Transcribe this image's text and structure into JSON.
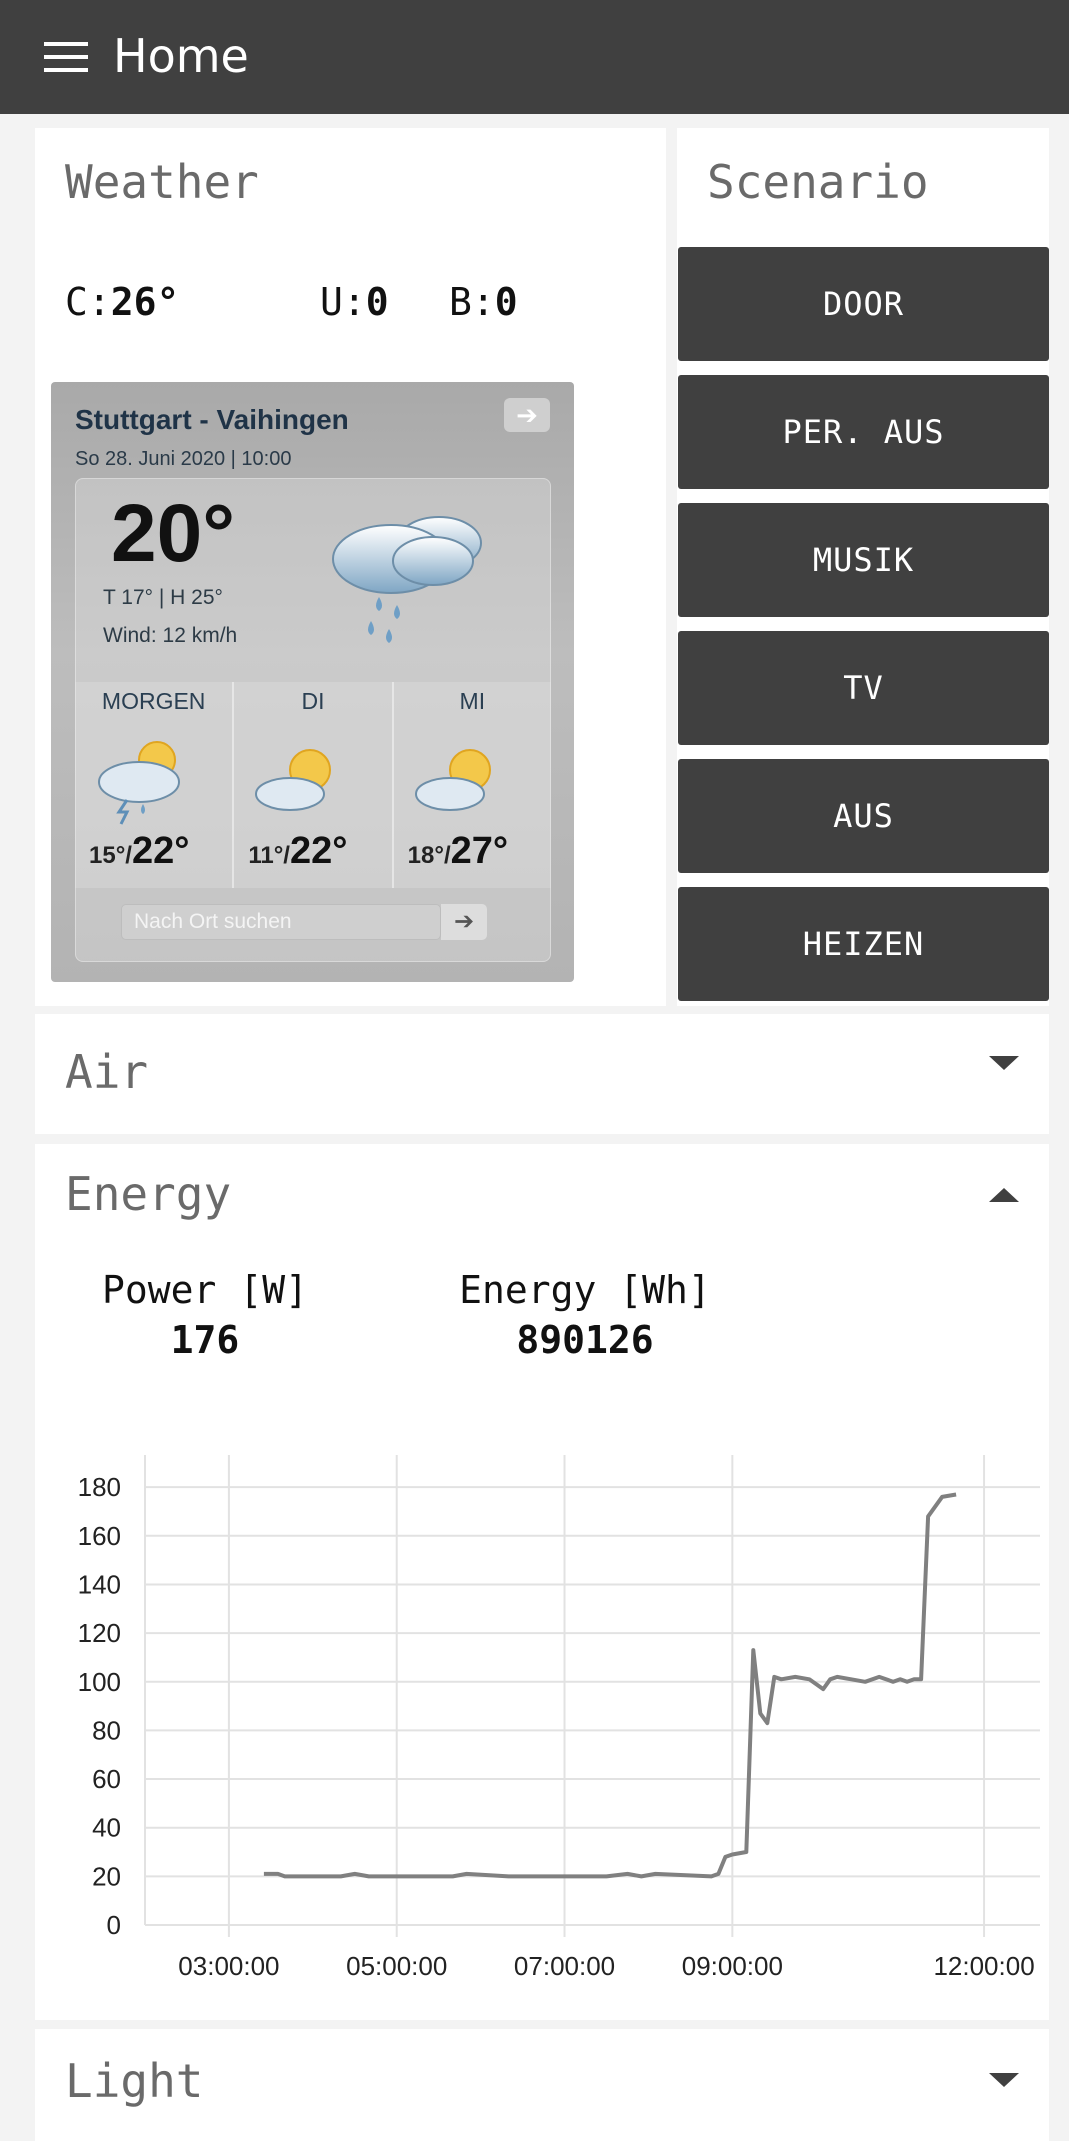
{
  "app": {
    "title": "Home",
    "menu_icon": "hamburger-menu-icon"
  },
  "weather": {
    "title": "Weather",
    "metrics": [
      {
        "key": "C:",
        "value": "26°"
      },
      {
        "key": "U:",
        "value": "0"
      },
      {
        "key": "B:",
        "value": "0"
      }
    ],
    "widget": {
      "city": "Stuttgart - Vaihingen",
      "date": "So 28. Juni 2020 | 10:00",
      "temp": "20°",
      "details": "T 17° | H 25°",
      "wind": "Wind: 12 km/h",
      "current_icon": "rain-cloud-icon",
      "days": [
        {
          "name": "MORGEN",
          "low": "15°/",
          "high": "22°",
          "icon": "thunder-sun-cloud-icon"
        },
        {
          "name": "DI",
          "low": "11°/",
          "high": "22°",
          "icon": "sun-cloud-icon"
        },
        {
          "name": "MI",
          "low": "18°/",
          "high": "27°",
          "icon": "sun-cloud-icon"
        }
      ],
      "search_placeholder": "Nach Ort suchen",
      "arrow_glyph": "➔"
    }
  },
  "scenario": {
    "title": "Scenario",
    "buttons": [
      "DOOR",
      "PER. AUS",
      "MUSIK",
      "TV",
      "AUS",
      "HEIZEN"
    ]
  },
  "sections": {
    "air": "Air",
    "energy": "Energy",
    "light": "Light"
  },
  "energy": {
    "power_label": "Power [W]",
    "power_value": "176",
    "energy_label": "Energy [Wh]",
    "energy_value": "890126"
  },
  "chart_data": {
    "type": "line",
    "title": "",
    "xlabel": "",
    "ylabel": "",
    "x_ticks": [
      "03:00:00",
      "05:00:00",
      "07:00:00",
      "09:00:00",
      "12:00:00"
    ],
    "y_ticks": [
      0,
      20,
      40,
      60,
      80,
      100,
      120,
      140,
      160,
      180
    ],
    "ylim": [
      0,
      185
    ],
    "xlim": [
      "02:00:00",
      "12:40:00"
    ],
    "grid": true,
    "color": "#808080",
    "series": [
      {
        "x": [
          "03:25",
          "03:35",
          "03:40",
          "04:00",
          "04:20",
          "04:30",
          "04:40",
          "05:00",
          "05:40",
          "05:50",
          "06:20",
          "07:30",
          "07:45",
          "07:55",
          "08:05",
          "08:45",
          "08:50",
          "08:55",
          "09:00",
          "09:10",
          "09:15",
          "09:20",
          "09:25",
          "09:30",
          "09:35",
          "09:45",
          "09:55",
          "10:05",
          "10:10",
          "10:15",
          "10:25",
          "10:35",
          "10:45",
          "10:55",
          "11:00",
          "11:05",
          "11:10",
          "11:15",
          "11:20",
          "11:30",
          "11:40"
        ],
        "y": [
          21,
          21,
          20,
          20,
          20,
          21,
          20,
          20,
          20,
          21,
          20,
          20,
          21,
          20,
          21,
          20,
          21,
          28,
          29,
          30,
          113,
          87,
          83,
          102,
          101,
          102,
          101,
          97,
          101,
          102,
          101,
          100,
          102,
          100,
          101,
          100,
          101,
          101,
          168,
          176,
          177
        ]
      }
    ]
  }
}
